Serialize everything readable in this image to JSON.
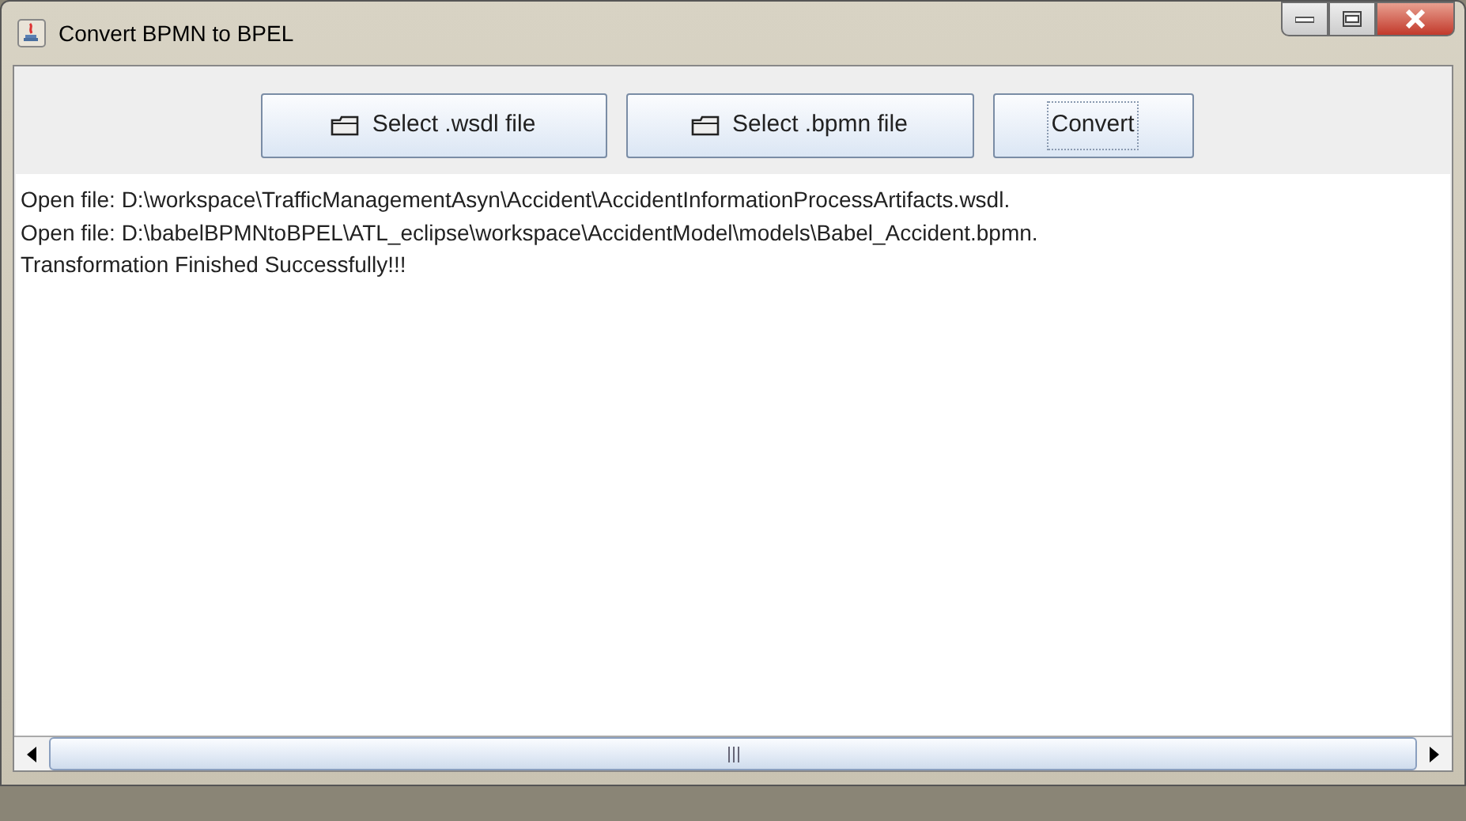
{
  "window": {
    "title": "Convert BPMN to BPEL"
  },
  "buttons": [
    {
      "label": "Select .wsdl file",
      "kind": "file",
      "focused": false
    },
    {
      "label": "Select .bpmn file",
      "kind": "file",
      "focused": false
    },
    {
      "label": "Convert",
      "kind": "action",
      "focused": true
    }
  ],
  "log": [
    "Open file: D:\\workspace\\TrafficManagementAsyn\\Accident\\AccidentInformationProcessArtifacts.wsdl.",
    "Open file: D:\\babelBPMNtoBPEL\\ATL_eclipse\\workspace\\AccidentModel\\models\\Babel_Accident.bpmn.",
    "Transformation Finished Successfully!!!"
  ]
}
